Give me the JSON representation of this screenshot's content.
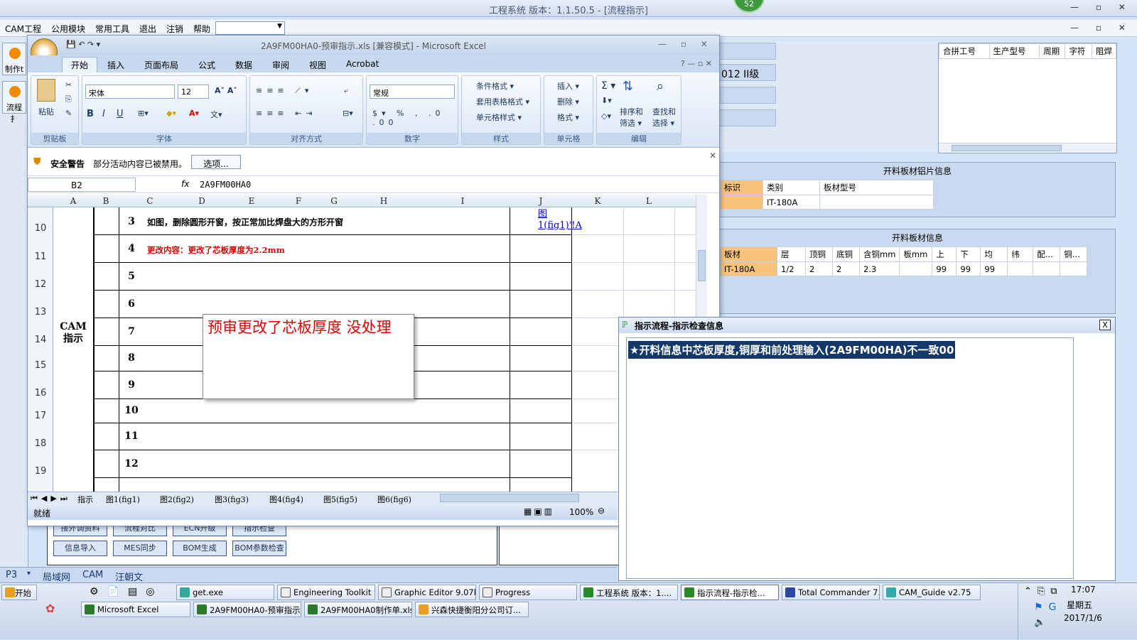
{
  "app": {
    "title": "工程系统   版本：1.1.50.5 - [流程指示]",
    "badge": "52"
  },
  "menu": [
    "CAM工程",
    "公用模块",
    "常用工具",
    "退出",
    "注销",
    "帮助"
  ],
  "leftbar": {
    "btn1": "制作t",
    "btn2": "流程扌"
  },
  "excel": {
    "title": "2A9FM00HA0-预审指示.xls  [兼容模式] - Microsoft Excel",
    "tabs": [
      "开始",
      "插入",
      "页面布局",
      "公式",
      "数据",
      "审阅",
      "视图",
      "Acrobat"
    ],
    "ribbon": {
      "clipboard": {
        "label": "剪贴板",
        "paste": "粘贴"
      },
      "font": {
        "label": "字体",
        "name": "宋体",
        "size": "12"
      },
      "align": {
        "label": "对齐方式"
      },
      "number": {
        "label": "数字",
        "format": "常规"
      },
      "styles": {
        "label": "样式",
        "cond": "条件格式 ▾",
        "table": "套用表格格式 ▾",
        "cell": "单元格样式 ▾"
      },
      "cells": {
        "label": "单元格",
        "insert": "插入 ▾",
        "delete": "删除 ▾",
        "format": "格式 ▾"
      },
      "edit": {
        "label": "编辑",
        "sort": "排序和",
        "sort2": "筛选 ▾",
        "find": "查找和",
        "find2": "选择 ▾"
      }
    },
    "security": {
      "title": "安全警告",
      "msg": "部分活动内容已被禁用。",
      "button": "选项..."
    },
    "namebox": "B2",
    "fx": "fx",
    "formula": "2A9FM00HA0",
    "columns": [
      "A",
      "B",
      "C",
      "D",
      "E",
      "F",
      "G",
      "H",
      "I",
      "J",
      "K",
      "L"
    ],
    "rows": [
      "10",
      "11",
      "12",
      "13",
      "14",
      "15",
      "16",
      "17",
      "18",
      "19"
    ],
    "merged_a": "CAM\n指示",
    "items": [
      {
        "n": "3",
        "text": "如图，删除圆形开窗，按正常加比焊盘大的方形开窗",
        "link": "图\n1(fig1)'!A"
      },
      {
        "n": "4",
        "text": "更改内容：更改了芯板厚度为2.2mm"
      },
      {
        "n": "5"
      },
      {
        "n": "6"
      },
      {
        "n": "7"
      },
      {
        "n": "8"
      },
      {
        "n": "9"
      },
      {
        "n": "10"
      },
      {
        "n": "11"
      },
      {
        "n": "12"
      }
    ],
    "popup": "预审更改了芯板厚度   没处理",
    "sheets": [
      "指示",
      "图1(fig1)",
      "图2(fig2)",
      "图3(fig3)",
      "图4(fig4)",
      "图5(fig5)",
      "图6(fig6)"
    ],
    "status": "就绪",
    "zoom": "100%"
  },
  "right": {
    "topfields": [
      "012 II级"
    ],
    "list_headers": [
      "合拼工号",
      "生产型号",
      "周期",
      "字符",
      "阻焊"
    ],
    "panel1": {
      "title": "开料板材铝片信息",
      "headers": [
        "标识",
        "类别",
        "板材型号"
      ],
      "row": [
        "",
        "IT-180A",
        ""
      ]
    },
    "panel2": {
      "title": "开料板材信息",
      "headers": [
        "板材",
        "层",
        "顶铜",
        "底铜",
        "含铜mm",
        "板mm",
        "上",
        "下",
        "均",
        "纬",
        "配...",
        "铜..."
      ],
      "row": [
        "IT-180A",
        "1/2",
        "2",
        "2",
        "2.3",
        "",
        "99",
        "99",
        "99",
        "",
        "",
        ""
      ]
    }
  },
  "dialog": {
    "title": "指示流程-指示检查信息",
    "message": "★开料信息中芯板厚度,铜厚和前处理输入(2A9FM00HA)不一致00",
    "close": "X"
  },
  "bottom_buttons": [
    "接外调资料",
    "流程对比",
    "ECN升级",
    "指示检查",
    "信息导入",
    "MES同步",
    "BOM生成",
    "BOM参数检查"
  ],
  "strip": {
    "p3": "P3",
    "lan": "局域网",
    "cam": "CAM",
    "user": "汪朝文"
  },
  "taskbar": {
    "start": "开始",
    "row1": [
      "get.exe",
      "Engineering Toolkit 9....",
      "Graphic Editor 9.07b2...",
      "Progress",
      "工程系统  版本：1....",
      "指示流程-指示检...",
      "Total Commander 7.0...",
      "CAM_Guide v2.75"
    ],
    "row2": [
      "Microsoft Excel",
      "2A9FM00HA0-预审指示...",
      "2A9FM00HA0制作单.xls...",
      "兴森快捷衡阳分公司订..."
    ],
    "time": "17:07",
    "day": "星期五",
    "date": "2017/1/6"
  }
}
